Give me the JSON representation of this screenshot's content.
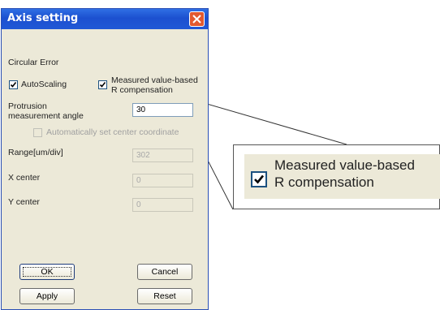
{
  "dialog": {
    "title": "Axis setting",
    "section_label": "Circular Error",
    "autoscaling": {
      "label": "AutoScaling",
      "checked": true
    },
    "r_compensation": {
      "label_line1": "Measured value-based",
      "label_line2": "R compensation",
      "checked": true
    },
    "protrusion": {
      "label_line1": "Protrusion",
      "label_line2": "measurement angle",
      "value": "30"
    },
    "auto_center": {
      "label": "Automatically set center coordinate",
      "checked": false,
      "enabled": false
    },
    "range": {
      "label": "Range[um/div]",
      "value": "302"
    },
    "x_center": {
      "label": "X center",
      "value": "0"
    },
    "y_center": {
      "label": "Y center",
      "value": "0"
    },
    "buttons": {
      "ok": "OK",
      "cancel": "Cancel",
      "apply": "Apply",
      "reset": "Reset"
    }
  },
  "zoom": {
    "label_line1": "Measured value-based",
    "label_line2": "R compensation",
    "checked": true
  },
  "colors": {
    "title_bar": "#2058d6",
    "dialog_bg": "#ece9d8",
    "close_button": "#e2592f"
  }
}
